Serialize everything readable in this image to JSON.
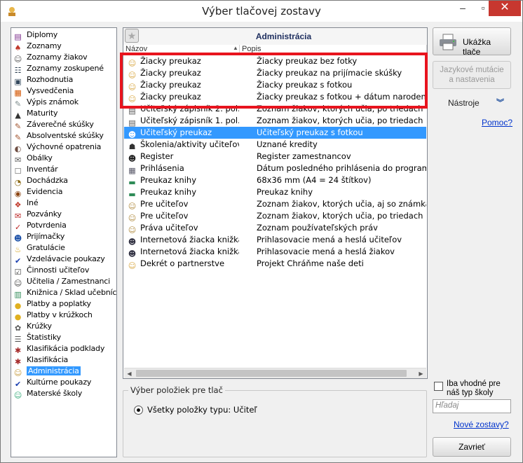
{
  "window": {
    "title": "Výber tlačovej zostavy"
  },
  "categories": [
    {
      "label": "Diplomy",
      "icon": "diploma-icon"
    },
    {
      "label": "Zoznamy",
      "icon": "list-icon"
    },
    {
      "label": "Zoznamy žiakov",
      "icon": "students-icon"
    },
    {
      "label": "Zoznamy zoskupené",
      "icon": "group-icon"
    },
    {
      "label": "Rozhodnutia",
      "icon": "decision-icon"
    },
    {
      "label": "Vysvedčenia",
      "icon": "certificate-icon"
    },
    {
      "label": "Výpis známok",
      "icon": "grades-icon"
    },
    {
      "label": "Maturity",
      "icon": "graduation-icon"
    },
    {
      "label": "Záverečné skúšky",
      "icon": "exam-icon"
    },
    {
      "label": "Absolventské skúšky",
      "icon": "exam-icon"
    },
    {
      "label": "Výchovné opatrenia",
      "icon": "measure-icon"
    },
    {
      "label": "Obálky",
      "icon": "envelope-icon"
    },
    {
      "label": "Inventár",
      "icon": "inventory-icon"
    },
    {
      "label": "Dochádzka",
      "icon": "attendance-icon"
    },
    {
      "label": "Evidencia",
      "icon": "records-icon"
    },
    {
      "label": "Iné",
      "icon": "other-icon"
    },
    {
      "label": "Pozvánky",
      "icon": "invitation-icon"
    },
    {
      "label": "Potvrdenia",
      "icon": "confirmation-icon"
    },
    {
      "label": "Prijímačky",
      "icon": "admission-icon"
    },
    {
      "label": "Gratulácie",
      "icon": "cake-icon"
    },
    {
      "label": "Vzdelávacie poukazy",
      "icon": "checkmark-icon"
    },
    {
      "label": "Činnosti učiteľov",
      "icon": "activity-icon"
    },
    {
      "label": "Učitelia / Zamestnanci",
      "icon": "teacher-icon"
    },
    {
      "label": "Knižnica / Sklad učebníc",
      "icon": "books-icon"
    },
    {
      "label": "Platby a poplatky",
      "icon": "payment-icon"
    },
    {
      "label": "Platby v krúžkoch",
      "icon": "payment-icon"
    },
    {
      "label": "Krúžky",
      "icon": "club-icon"
    },
    {
      "label": "Štatistiky",
      "icon": "statistics-icon"
    },
    {
      "label": "Klasifikácia podklady",
      "icon": "classification-icon"
    },
    {
      "label": "Klasifikácia",
      "icon": "classification-icon"
    },
    {
      "label": "Administrácia",
      "icon": "admin-icon",
      "selected": true
    },
    {
      "label": "Kultúrne poukazy",
      "icon": "checkmark-icon"
    },
    {
      "label": "Materské školy",
      "icon": "kindergarten-icon"
    }
  ],
  "panel": {
    "title": "Administrácia",
    "col_name": "Názov",
    "col_desc": "Popis"
  },
  "reports": [
    {
      "name": "Žiacky preukaz",
      "desc": "Žiacky preukaz bez fotky",
      "icon": "student-card-icon"
    },
    {
      "name": "Žiacky preukaz",
      "desc": "Žiacky preukaz na prijímacie skúšky",
      "icon": "student-card-icon"
    },
    {
      "name": "Žiacky preukaz",
      "desc": "Žiacky preukaz s fotkou",
      "icon": "student-card-icon"
    },
    {
      "name": "Žiacky preukaz",
      "desc": "Žiacky preukaz s fotkou + dátum narodenia",
      "icon": "student-card-icon"
    },
    {
      "name": "Učiteľský zápisník 2. pol.",
      "desc": "Zoznam žiakov, ktorých učia, po triedach na",
      "icon": "teacher-notebook-icon"
    },
    {
      "name": "Učiteľský zápisník 1. pol.",
      "desc": "Zoznam žiakov, ktorých učia, po triedach na",
      "icon": "teacher-notebook-icon"
    },
    {
      "name": "Učiteľský preukaz",
      "desc": "Učiteľský preukaz s fotkou",
      "icon": "teacher-card-icon",
      "selected": true
    },
    {
      "name": "Školenia/aktivity učiteľov",
      "desc": "Uznané kredity",
      "icon": "training-icon"
    },
    {
      "name": "Register",
      "desc": "Register zamestnancov",
      "icon": "register-icon"
    },
    {
      "name": "Prihlásenia",
      "desc": "Dátum posledného prihlásenia do programu",
      "icon": "login-icon"
    },
    {
      "name": "Preukaz knihy",
      "desc": "68x36 mm (A4 = 24 štítkov)",
      "icon": "book-icon"
    },
    {
      "name": "Preukaz knihy",
      "desc": "Preukaz knihy",
      "icon": "book-icon"
    },
    {
      "name": "Pre učiteľov",
      "desc": "Zoznam žiakov, ktorých učia, aj so známkam",
      "icon": "person-icon"
    },
    {
      "name": "Pre učiteľov",
      "desc": "Zoznam žiakov, ktorých učia, po triedach",
      "icon": "person-icon"
    },
    {
      "name": "Práva učiteľov",
      "desc": "Zoznam používateľských práv",
      "icon": "person-icon"
    },
    {
      "name": "Internetová žiacka knižka",
      "desc": "Prihlasovacie mená a heslá učiteľov",
      "icon": "teacher-card-icon"
    },
    {
      "name": "Internetová žiacka knižka",
      "desc": "Prihlasovacie mená a heslá žiakov",
      "icon": "teacher-card-icon"
    },
    {
      "name": "Dekrét o partnerstve",
      "desc": "Projekt Chráňme naše deti",
      "icon": "student-card-icon"
    }
  ],
  "selection_group": {
    "legend": "Výber položiek pre tlač",
    "option_label": "Všetky položky typu: Učiteľ"
  },
  "sidebar_right": {
    "preview_label": "Ukážka tlače",
    "lang_line1": "Jazykové mutácie",
    "lang_line2": "a nastavenia",
    "tools_label": "Nástroje",
    "help_link": "Pomoc?",
    "filter_checkbox": "Iba vhodné pre náš typ školy",
    "search_placeholder": "Hľadaj",
    "new_reports_link": "Nové zostavy?",
    "close_label": "Zavrieť"
  },
  "colors": {
    "selection": "#3399ff",
    "highlight_box": "#e8141e",
    "link": "#0033cc"
  }
}
